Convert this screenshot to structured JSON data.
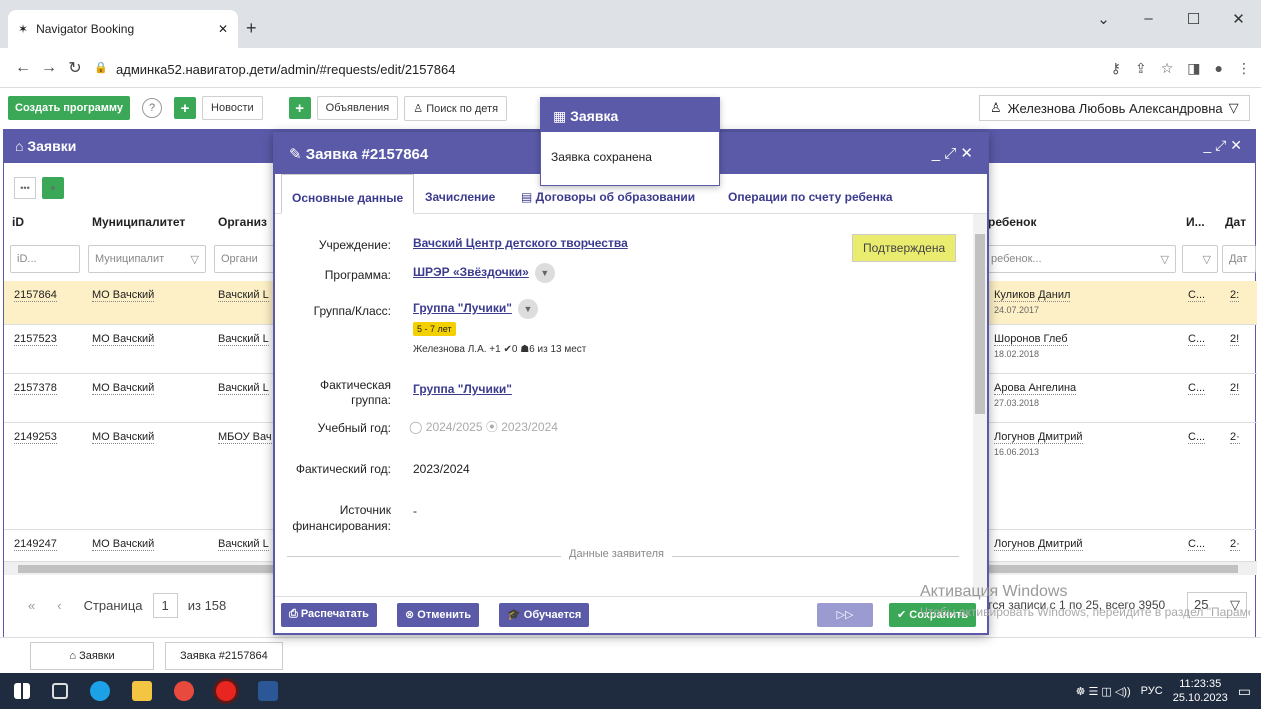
{
  "browser": {
    "tab_title": "Navigator Booking",
    "url": "админка52.навигатор.дети/admin/#requests/edit/2157864"
  },
  "toolbar": {
    "create_program": "Создать программу",
    "help": "?",
    "news": "Новости",
    "announcements": "Объявления",
    "search_child": "Поиск по детя",
    "user": "Железнова Любовь Александровна"
  },
  "main": {
    "title": "Заявки",
    "columns": [
      "iD",
      "Муниципалитет",
      "Организ",
      "ребенок",
      "И...",
      "Дат"
    ],
    "filters": [
      "iD...",
      "Муниципалит",
      "Органи",
      "ребенок...",
      "",
      "Дат"
    ],
    "rows": [
      {
        "id": "2157864",
        "mun": "МО Вачский",
        "org": "Вачский L",
        "child": "Куликов Данил",
        "dob": "24.07.2017",
        "i": "С...",
        "d": "2:"
      },
      {
        "id": "2157523",
        "mun": "МО Вачский",
        "org": "Вачский L",
        "child": "Шоронов Глеб",
        "dob": "18.02.2018",
        "i": "С...",
        "d": "2!"
      },
      {
        "id": "2157378",
        "mun": "МО Вачский",
        "org": "Вачский L",
        "child": "Арова Ангелина",
        "dob": "27.03.2018",
        "i": "С...",
        "d": "2!"
      },
      {
        "id": "2149253",
        "mun": "МО Вачский",
        "org": "МБОУ Вач",
        "child": "Логунов Дмитрий",
        "dob": "16.06.2013",
        "i": "С...",
        "d": "2·"
      },
      {
        "id": "2149247",
        "mun": "МО Вачский",
        "org": "Вачский L",
        "child": "Логунов Дмитрий",
        "dob": "",
        "i": "С...",
        "d": "2·"
      }
    ],
    "pager": {
      "page_label": "Страница",
      "page": "1",
      "of": "из 158",
      "records": "тся записи с 1 по 25, всего 3950",
      "per_page": "25"
    }
  },
  "modal": {
    "title": "Заявка #2157864",
    "tabs": [
      "Основные данные",
      "Зачисление",
      "Договоры об образовании",
      "Операции по счету ребенка"
    ],
    "labels": {
      "institution": "Учреждение:",
      "program": "Программа:",
      "group": "Группа/Класс:",
      "actual_group": "Фактическая группа:",
      "school_year": "Учебный год:",
      "actual_year": "Фактический год:",
      "funding": "Источник финансирования:"
    },
    "values": {
      "institution": "Вачский Центр детского творчества",
      "program": "ШРЭР «Звёздочки»",
      "group": "Группа \"Лучики\"",
      "age": "5 - 7 лет",
      "group_info": "Железнова Л.А.   +1  ✔0  ☗6   из 13 мест",
      "actual_group": "Группа \"Лучики\"",
      "year_a": "2024/2025",
      "year_b": "2023/2024",
      "actual_year": "2023/2024",
      "funding": "-",
      "status": "Подтверждена",
      "section": "Данные заявителя"
    },
    "footer": {
      "print": "Распечатать",
      "cancel": "Отменить",
      "studying": "Обучается",
      "save": "Сохранить"
    }
  },
  "notification": {
    "title": "Заявка",
    "text": "Заявка сохранена"
  },
  "bottom_tabs": [
    "Заявки",
    "Заявка #2157864"
  ],
  "watermark": {
    "line1": "Активация Windows",
    "line2": "Чтобы активировать Windows, перейдите в раздел \"Параметры\"."
  },
  "tray": {
    "lang": "РУС",
    "time": "11:23:35",
    "date": "25.10.2023"
  }
}
